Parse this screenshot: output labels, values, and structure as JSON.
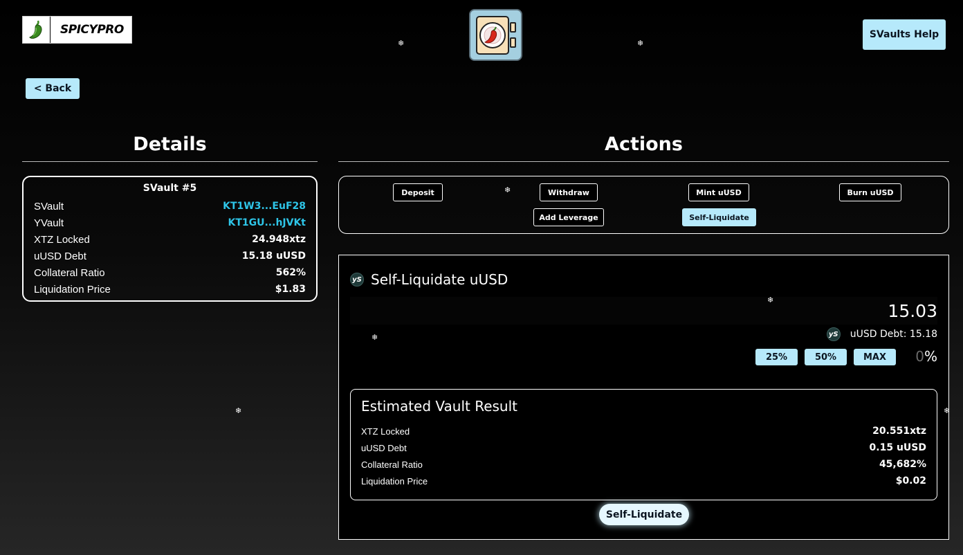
{
  "header": {
    "brand": "SPICYPRO",
    "help_label": "SVaults Help",
    "back_label": "< Back"
  },
  "details": {
    "section_title": "Details",
    "card_title": "SVault #5",
    "rows": [
      {
        "label": "SVault",
        "value": "KT1W3...EuF28",
        "link": true
      },
      {
        "label": "YVault",
        "value": "KT1GU...hJVKt",
        "link": true
      },
      {
        "label": "XTZ Locked",
        "value": "24.948xtz",
        "link": false
      },
      {
        "label": "uUSD Debt",
        "value": "15.18 uUSD",
        "link": false
      },
      {
        "label": "Collateral Ratio",
        "value": "562%",
        "link": false
      },
      {
        "label": "Liquidation Price",
        "value": "$1.83",
        "link": false
      }
    ]
  },
  "actions": {
    "section_title": "Actions",
    "tabs": [
      "Deposit",
      "Withdraw",
      "Mint uUSD",
      "Burn uUSD",
      "Add Leverage",
      "Self-Liquidate"
    ],
    "active_tab": "Self-Liquidate"
  },
  "self_liquidate": {
    "badge": "yS",
    "title": "Self-Liquidate uUSD",
    "amount": "15.03",
    "debt_text": "uUSD Debt: 15.18",
    "pct_buttons": [
      "25%",
      "50%",
      "MAX"
    ],
    "pct_value": "0",
    "pct_sign": "%",
    "submit_label": "Self-Liquidate"
  },
  "estimated": {
    "title": "Estimated Vault Result",
    "rows": [
      {
        "label": "XTZ Locked",
        "value": "20.551xtz"
      },
      {
        "label": "uUSD Debt",
        "value": "0.15 uUSD"
      },
      {
        "label": "Collateral Ratio",
        "value": "45,682%"
      },
      {
        "label": "Liquidation Price",
        "value": "$0.02"
      }
    ]
  },
  "colors": {
    "accent": "#b6e9fb",
    "link": "#2ec5e8",
    "pepper_green": "#3a8a1f"
  },
  "icons": [
    "pepper-logo-icon",
    "vault-icon",
    "yusd-token-icon",
    "snowflake-icon"
  ]
}
